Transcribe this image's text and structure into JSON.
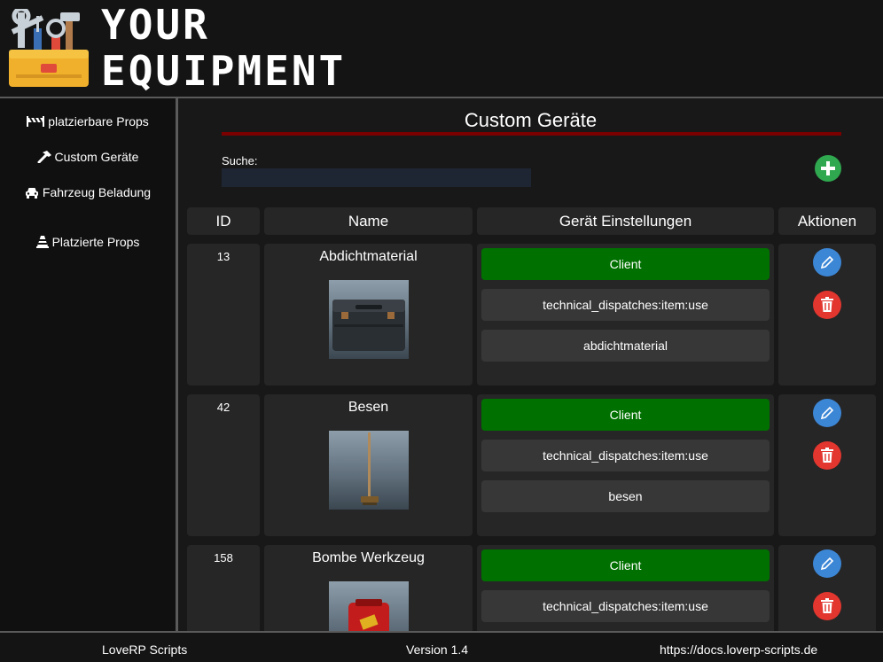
{
  "header": {
    "title_line1": "YOUR",
    "title_line2": "EQUIPMENT"
  },
  "sidebar": {
    "items": [
      {
        "label": "platzierbare Props",
        "icon": "barrier-icon"
      },
      {
        "label": "Custom Geräte",
        "icon": "hammer-icon"
      },
      {
        "label": "Fahrzeug Beladung",
        "icon": "car-icon"
      },
      {
        "label": "Platzierte Props",
        "icon": "traffic-cone-icon"
      }
    ]
  },
  "main": {
    "title": "Custom Geräte",
    "search": {
      "label": "Suche:",
      "value": "",
      "placeholder": ""
    },
    "add_icon": "plus-circle-icon",
    "columns": [
      "ID",
      "Name",
      "Gerät Einstellungen",
      "Aktionen"
    ],
    "rows": [
      {
        "id": "13",
        "name": "Abdichtmaterial",
        "settings": [
          "Client",
          "technical_dispatches:item:use",
          "abdichtmaterial"
        ]
      },
      {
        "id": "42",
        "name": "Besen",
        "settings": [
          "Client",
          "technical_dispatches:item:use",
          "besen"
        ]
      },
      {
        "id": "158",
        "name": "Bombe Werkzeug",
        "settings": [
          "Client",
          "technical_dispatches:item:use",
          ""
        ]
      }
    ],
    "action_icons": {
      "edit": "pencil-icon",
      "delete": "trash-icon"
    },
    "colors": {
      "client": "#007000",
      "edit": "#3c86d6",
      "delete": "#e2362f",
      "add": "#2fa84f",
      "underline": "#7a0000"
    }
  },
  "footer": {
    "left": "LoveRP Scripts",
    "center": "Version 1.4",
    "right": "https://docs.loverp-scripts.de"
  }
}
